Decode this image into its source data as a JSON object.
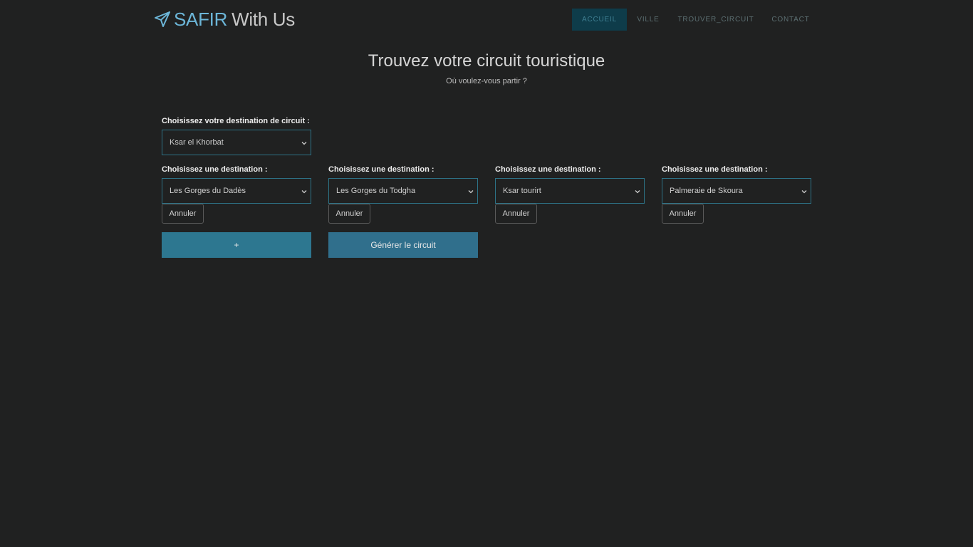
{
  "brand": {
    "part1": "SAFIR",
    "part2": "With Us",
    "icon": "paper-plane-icon"
  },
  "nav": {
    "items": [
      {
        "label": "ACCUEIL",
        "active": true
      },
      {
        "label": "VILLE",
        "active": false
      },
      {
        "label": "TROUVER_CIRCUIT",
        "active": false
      },
      {
        "label": "CONTACT",
        "active": false
      }
    ]
  },
  "page": {
    "title": "Trouvez votre circuit touristique",
    "subtitle": "Où voulez-vous partir ?"
  },
  "circuit": {
    "label": "Choisissez votre destination de circuit :",
    "selected": "Ksar el Khorbat"
  },
  "destinations": [
    {
      "label": "Choisissez une destination :",
      "selected": "Les Gorges du Dadès",
      "cancel": "Annuler"
    },
    {
      "label": "Choisissez une destination :",
      "selected": "Les Gorges du Todgha",
      "cancel": "Annuler"
    },
    {
      "label": "Choisissez une destination :",
      "selected": "Ksar tourirt",
      "cancel": "Annuler"
    },
    {
      "label": "Choisissez une destination :",
      "selected": "Palmeraie de Skoura",
      "cancel": "Annuler"
    }
  ],
  "actions": {
    "add_label": "+",
    "generate_label": "Générer le circuit"
  },
  "colors": {
    "accent": "#2d7790",
    "background": "#202121",
    "nav_active": "#0e3c4a"
  }
}
